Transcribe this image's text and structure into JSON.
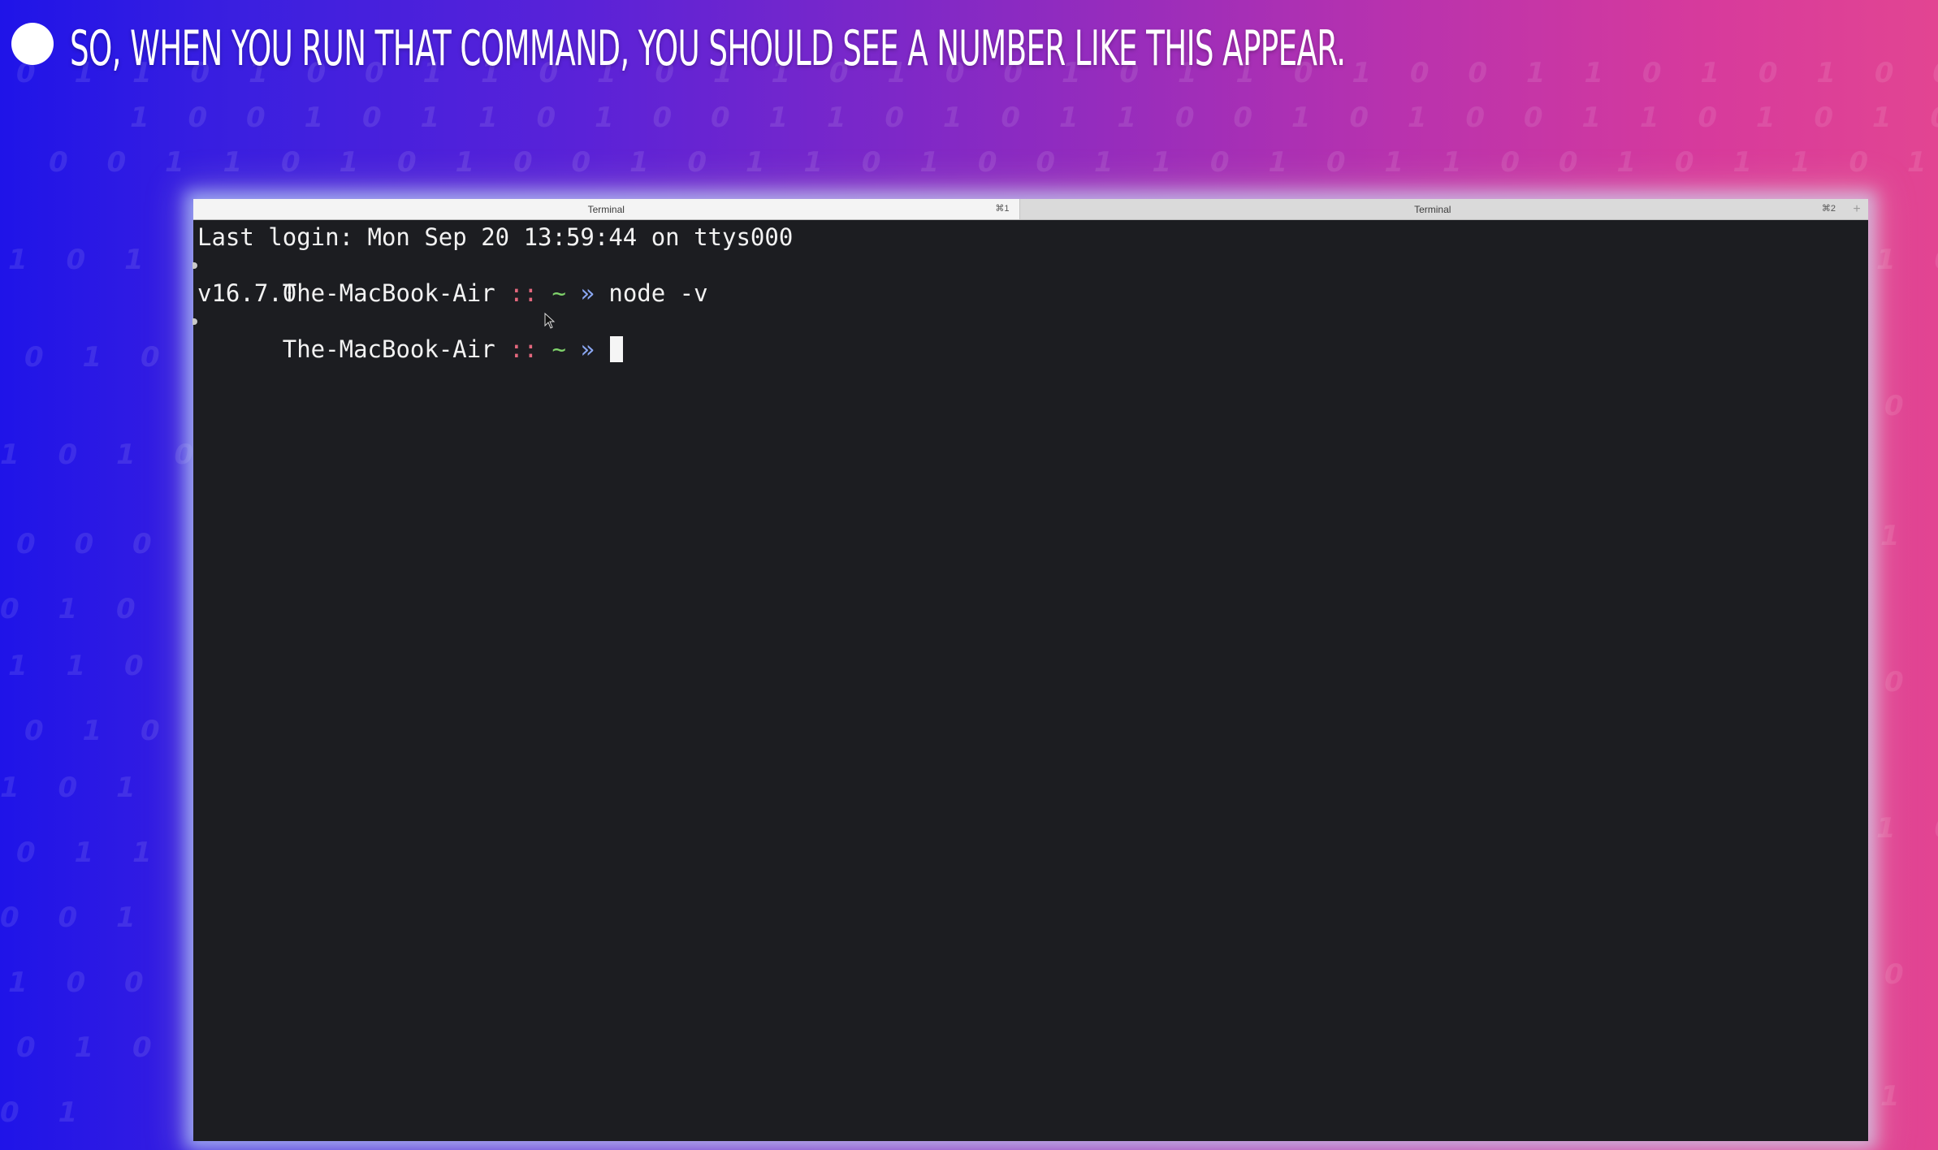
{
  "caption": {
    "text": "SO, WHEN YOU RUN THAT COMMAND, YOU SHOULD SEE A NUMBER LIKE THIS APPEAR."
  },
  "terminal": {
    "tabs": [
      {
        "title": "Terminal",
        "shortcut": "⌘1"
      },
      {
        "title": "Terminal",
        "shortcut": "⌘2"
      }
    ],
    "new_tab_label": "+",
    "lines": {
      "last_login": "Last login: Mon Sep 20 13:59:44 on ttys000",
      "prompt1": {
        "host": "The-MacBook-Air",
        "sep": " :: ",
        "dir": "~",
        "arrow": " » ",
        "command": "node -v"
      },
      "output": "v16.7.0",
      "prompt2": {
        "host": "The-MacBook-Air",
        "sep": " :: ",
        "dir": "~",
        "arrow": " » "
      }
    }
  },
  "colors": {
    "terminal_bg": "#1c1d21",
    "prompt_separator": "#e2677d",
    "prompt_dir": "#7fd26b",
    "prompt_arrow": "#8aa7f2"
  },
  "icons": {
    "bullet": "white-circle",
    "mouse_pointer": "arrow-cursor-icon"
  }
}
